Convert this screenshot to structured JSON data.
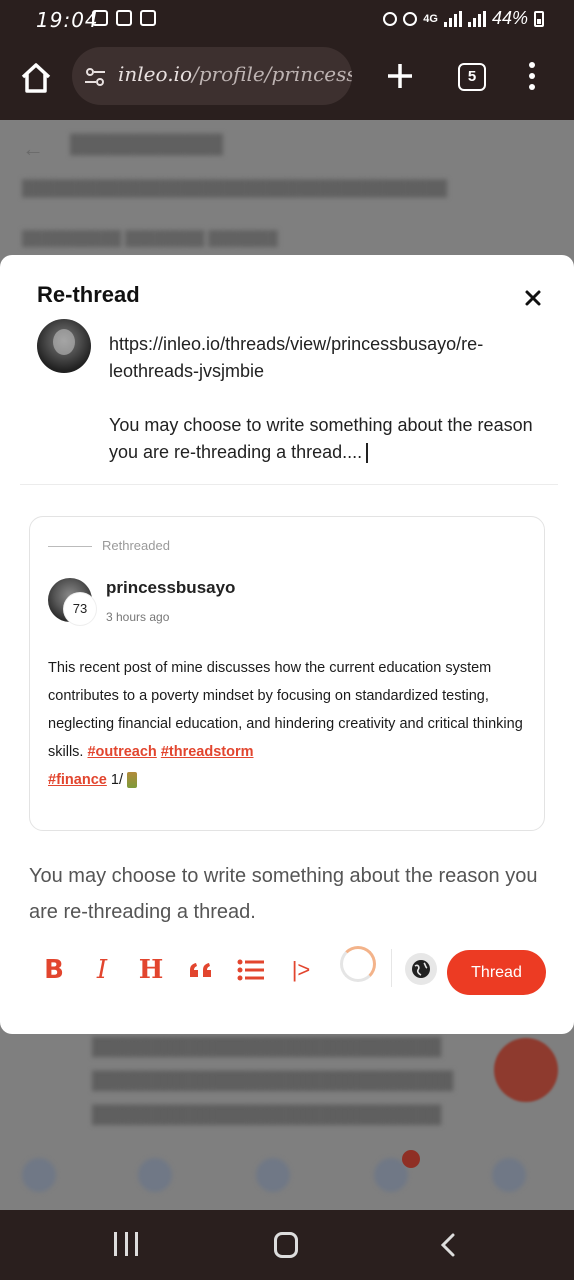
{
  "status_bar": {
    "time": "19:04",
    "network": "4G",
    "battery": "44%"
  },
  "browser": {
    "url_host": "inleo.io",
    "url_path": "/profile/princessbu",
    "tab_count": "5"
  },
  "modal": {
    "title": "Re-thread",
    "compose_link": "https://inleo.io/threads/view/princessbusayo/re-leothreads-jvsjmbie",
    "compose_text": "You may choose to write something about the reason you are re-threading a thread....",
    "card": {
      "label": "Rethreaded",
      "username": "princessbusayo",
      "reputation": "73",
      "time": "3 hours ago",
      "body": "This recent post of mine discusses how the current education system contributes to a poverty mindset by focusing on standardized testing, neglecting financial education, and hindering creativity and critical thinking skills.",
      "tags": [
        "#outreach",
        "#threadstorm",
        "#finance"
      ],
      "suffix": "1/"
    },
    "placeholder": "You may choose to write something about the reason you are re-threading a thread.",
    "toolbar": {
      "bold": "B",
      "italic": "I",
      "heading": "H",
      "quote": "“",
      "code": "|>"
    },
    "submit_label": "Thread"
  },
  "colors": {
    "accent": "#ec3b23",
    "tag": "#e2452e"
  }
}
